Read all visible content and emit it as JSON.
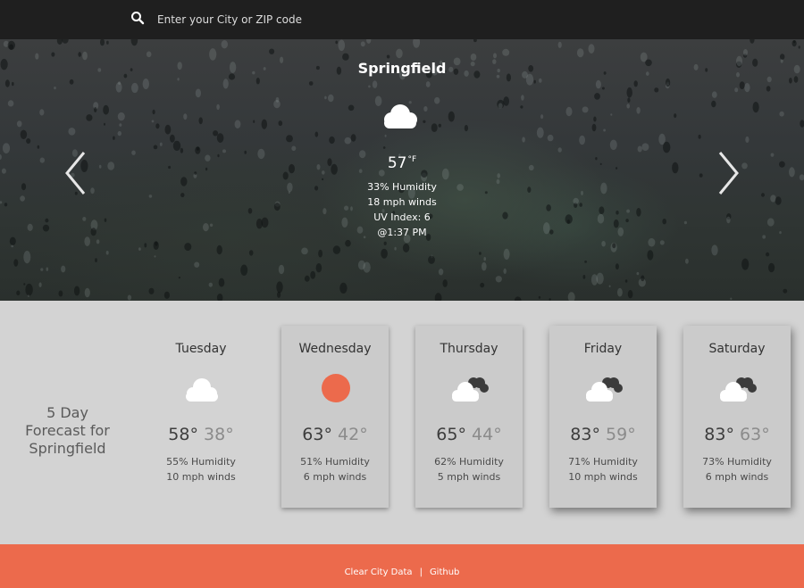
{
  "search": {
    "placeholder": "Enter your City or ZIP code",
    "value": ""
  },
  "current": {
    "city": "Springfield",
    "icon": "cloud-icon",
    "temp": "57",
    "unit": "°F",
    "humidity": "33% Humidity",
    "winds": "18 mph winds",
    "uv": "UV Index: 6",
    "time": "@1:37 PM"
  },
  "forecast": {
    "title": "5 Day Forecast for Springfield",
    "days": [
      {
        "day": "Tuesday",
        "icon": "cloud-icon",
        "hi": "58°",
        "lo": "38°",
        "humidity": "55% Humidity",
        "winds": "10 mph winds"
      },
      {
        "day": "Wednesday",
        "icon": "sun-icon",
        "hi": "63°",
        "lo": "42°",
        "humidity": "51% Humidity",
        "winds": "6 mph winds"
      },
      {
        "day": "Thursday",
        "icon": "dark-clouds-icon",
        "hi": "65°",
        "lo": "44°",
        "humidity": "62% Humidity",
        "winds": "5 mph winds"
      },
      {
        "day": "Friday",
        "icon": "dark-clouds-icon",
        "hi": "83°",
        "lo": "59°",
        "humidity": "71% Humidity",
        "winds": "10 mph winds"
      },
      {
        "day": "Saturday",
        "icon": "dark-clouds-icon",
        "hi": "83°",
        "lo": "63°",
        "humidity": "73% Humidity",
        "winds": "6 mph winds"
      }
    ]
  },
  "footer": {
    "clear": "Clear City Data",
    "sep": "|",
    "github": "Github"
  },
  "colors": {
    "accent": "#ec6a4c",
    "topbar": "#1f1f1f",
    "sun": "#ec6a4c",
    "background": "#d3d3d3"
  }
}
